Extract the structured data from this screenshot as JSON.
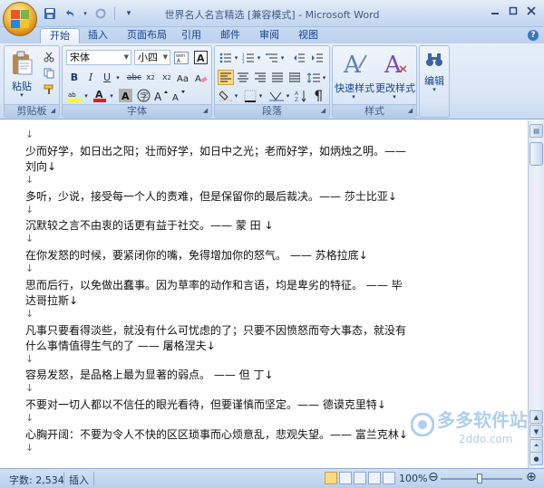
{
  "window": {
    "title": "世界名人名言精选 [兼容模式] - Microsoft Word",
    "quick_access": [
      "save-icon",
      "undo-icon",
      "redo-icon",
      "customize-icon"
    ]
  },
  "tabs": [
    "开始",
    "插入",
    "页面布局",
    "引用",
    "邮件",
    "审阅",
    "视图"
  ],
  "ribbon": {
    "clipboard": {
      "label": "剪贴板",
      "paste_label": "粘贴"
    },
    "font": {
      "label": "字体",
      "font_name": "宋体",
      "font_size": "小四"
    },
    "paragraph": {
      "label": "段落"
    },
    "styles": {
      "label": "样式",
      "quick_styles": "快速样式",
      "change_styles": "更改样式"
    },
    "editing": {
      "label": "编辑"
    }
  },
  "document": {
    "lines": [
      "少而好学，如日出之阳；壮而好学，如日中之光；老而好学，如炳烛之明。——",
      "刘向↓",
      "多听，少说，接受每一个人的责难，但是保留你的最后裁决。—— 莎士比亚↓",
      "沉默较之言不由衷的话更有益于社交。—— 蒙  田   ↓",
      "在你发怒的时候，要紧闭你的嘴，免得增加你的怒气。 —— 苏格拉底↓",
      "思而后行，以免做出蠢事。因为草率的动作和言语，均是卑劣的特征。 —— 毕",
      "达哥拉斯↓",
      "凡事只要看得淡些，就没有什么可忧虑的了；只要不因愤怒而夸大事态，就没有",
      "什么事情值得生气的了    —— 屠格涅夫↓",
      "容易发怒，是品格上最为显著的弱点。 —— 但  丁↓",
      "不要对一切人都以不信任的眼光看待，但要谨慎而坚定。—— 德谟克里特↓",
      "心胸开阔：不要为令人不快的区区琐事而心烦意乱，悲观失望。—— 富兰克林↓"
    ],
    "para_mark": "↓"
  },
  "status": {
    "word_count": "字数: 2,534",
    "mode": "插入",
    "zoom": "100%"
  },
  "watermark": {
    "text": "多多软件站",
    "url": "2ddo.com"
  },
  "colors": {
    "accent": "#15428b",
    "ribbon_bg": "#dbe7f7",
    "status_bg": "#c6d9f0"
  }
}
